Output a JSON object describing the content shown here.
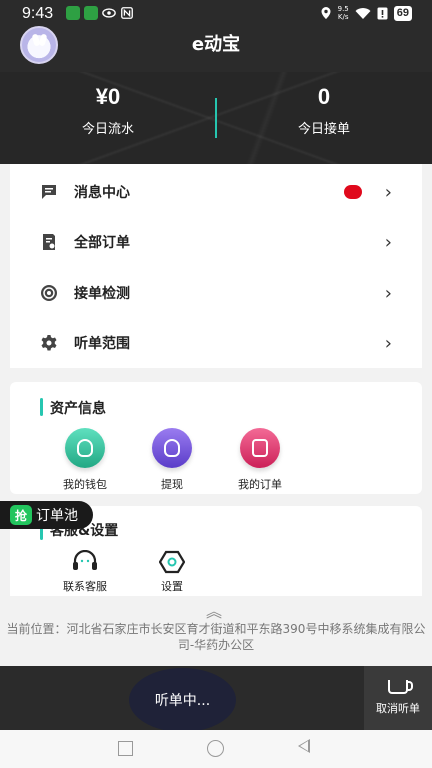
{
  "status_bar": {
    "time": "9:43",
    "net_speed_top": "9.5",
    "net_speed_unit": "K/s",
    "battery": "69"
  },
  "header": {
    "app_title": "e动宝",
    "stats": [
      {
        "value": "¥0",
        "label": "今日流水"
      },
      {
        "value": "0",
        "label": "今日接单"
      }
    ]
  },
  "menu": {
    "items": [
      {
        "label": "消息中心",
        "icon": "message-icon",
        "has_unread_dot": true
      },
      {
        "label": "全部订单",
        "icon": "order-doc-icon"
      },
      {
        "label": "接单检测",
        "icon": "detect-icon"
      },
      {
        "label": "听单范围",
        "icon": "gear-icon"
      }
    ],
    "chevron": "›"
  },
  "assets": {
    "title": "资产信息",
    "tiles": [
      {
        "label": "我的钱包",
        "icon": "wallet-icon",
        "color": "#2dbf9a"
      },
      {
        "label": "提现",
        "icon": "withdraw-icon",
        "color": "#6d4fd8"
      },
      {
        "label": "我的订单",
        "icon": "my-orders-icon",
        "color": "#e0356a"
      }
    ]
  },
  "service": {
    "title": "客服&设置",
    "tiles": [
      {
        "label": "联系客服",
        "icon": "headset-icon"
      },
      {
        "label": "设置",
        "icon": "settings-hex-icon"
      }
    ]
  },
  "order_pool_badge": {
    "tag": "抢",
    "label": "订单池"
  },
  "location": {
    "expand_icon": "︽",
    "text": "当前位置：河北省石家庄市长安区育才街道和平东路390号中移系统集成有限公司-华药办公区"
  },
  "bottom_bar": {
    "listen_label": "听单中...",
    "cancel_label": "取消听单"
  },
  "colors": {
    "accent": "#26c6b0",
    "dark_bg": "#2b2b2b",
    "alert_red": "#e0091c"
  }
}
